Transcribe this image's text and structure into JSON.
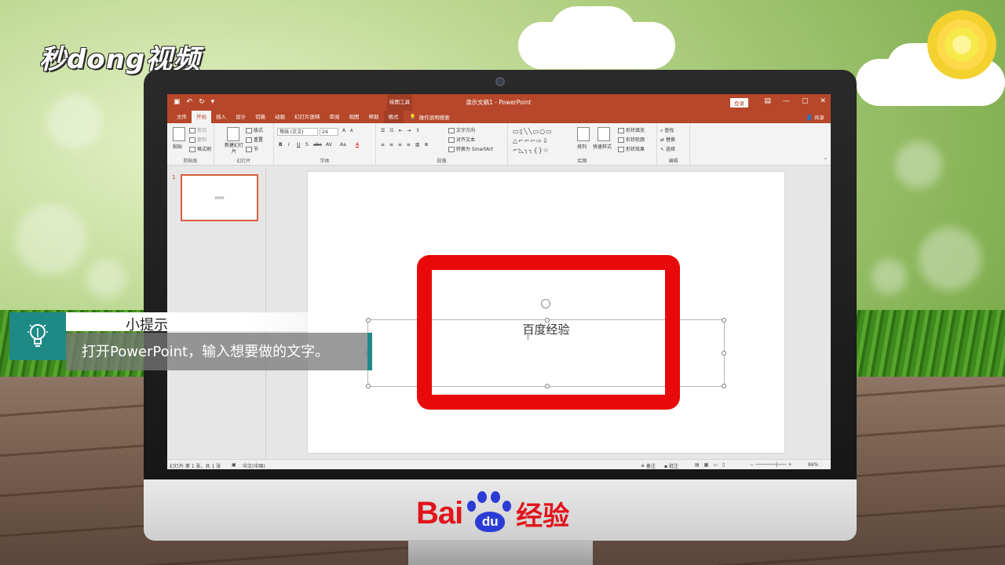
{
  "watermark": {
    "logo_text": "秒dong视频"
  },
  "brand": {
    "bai": "Bai",
    "du": "du",
    "jingyan": "经验"
  },
  "ppt": {
    "window_title": "演示文稿1 - PowerPoint",
    "context_tab_group": "绘图工具",
    "login_label": "登录",
    "share_label": "共享",
    "tabs": [
      "文件",
      "开始",
      "插入",
      "设计",
      "切换",
      "动画",
      "幻灯片放映",
      "审阅",
      "视图",
      "帮助",
      "格式"
    ],
    "active_tab": "开始",
    "tell_me": "操作说明搜索",
    "ribbon": {
      "clipboard": {
        "name": "剪贴板",
        "paste": "粘贴",
        "cut": "剪切",
        "copy": "复制",
        "format_painter": "格式刷"
      },
      "slides": {
        "name": "幻灯片",
        "new_slide": "新建幻灯片",
        "layout": "版式",
        "reset": "重置",
        "section": "节"
      },
      "font": {
        "name": "字体",
        "font_family": "等线 (正文)",
        "font_size": "24",
        "bold": "B",
        "italic": "I",
        "underline": "U",
        "strike": "S",
        "shadow": "abc",
        "spacing": "AV",
        "case": "Aa",
        "color": "A",
        "grow": "A",
        "shrink": "A"
      },
      "paragraph": {
        "name": "段落",
        "text_direction": "文字方向",
        "align_text": "对齐文本",
        "smartart": "转换为 SmartArt"
      },
      "drawing": {
        "name": "绘图",
        "arrange": "排列",
        "quick_styles": "快速样式",
        "fill": "形状填充",
        "outline": "形状轮廓",
        "effects": "形状效果"
      },
      "editing": {
        "name": "编辑",
        "find": "查找",
        "replace": "替换",
        "select": "选择"
      }
    },
    "slide_number": "1",
    "thumbnail_text": "百度经验",
    "slide_text": "百度经验",
    "status": {
      "slide_info": "幻灯片 第 1 张，共 1 张",
      "language": "中文(中国)",
      "notes": "备注",
      "comments": "批注",
      "zoom": "86%"
    }
  },
  "tip": {
    "title": "小提示",
    "body": "打开PowerPoint，输入想要做的文字。"
  },
  "colors": {
    "ppt_accent": "#b7472a",
    "highlight_box": "#e80a0a",
    "tip_teal": "#1d8a86"
  }
}
